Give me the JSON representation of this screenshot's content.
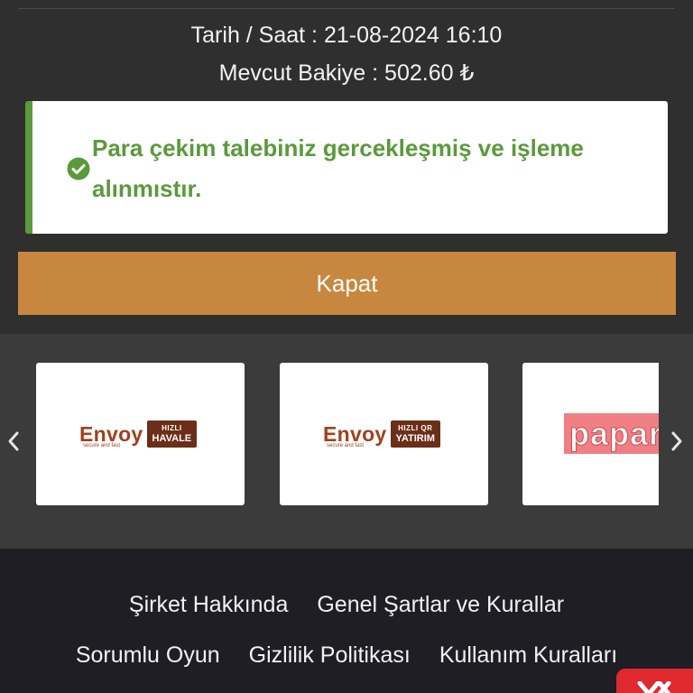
{
  "info": {
    "datetime": "Tarih / Saat : 21-08-2024 16:10",
    "balance": "Mevcut Bakiye : 502.60 ₺"
  },
  "alert": {
    "message": "Para çekim talebiniz gercekleşmiş ve işleme alınmıstır.",
    "icon": "check-circle-icon",
    "color": "#5a9a3b"
  },
  "close_button": {
    "label": "Kapat",
    "color": "#c8873f"
  },
  "payment_methods": [
    {
      "brand": "Envoy",
      "tagline": "secure and fast",
      "badge_top": "HIZLI",
      "badge_bottom": "HAVALE"
    },
    {
      "brand": "Envoy",
      "tagline": "secure and fast",
      "badge_top": "HIZLI QR",
      "badge_bottom": "YATIRIM"
    },
    {
      "brand": "papara"
    }
  ],
  "carousel": {
    "prev_icon": "chevron-left-icon",
    "next_icon": "chevron-right-icon"
  },
  "footer": {
    "links_row1": [
      "Şirket Hakkında",
      "Genel Şartlar ve Kurallar"
    ],
    "links_row2": [
      "Sorumlu Oyun",
      "Gizlilik Politikası",
      "Kullanım Kuralları"
    ]
  },
  "chat_badge": {
    "icon": "close-icon",
    "color": "#e0282f"
  }
}
